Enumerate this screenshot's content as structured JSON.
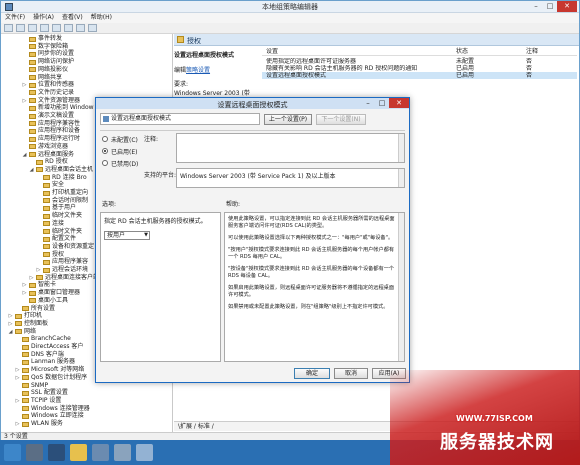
{
  "window": {
    "title": "本地组策略编辑器",
    "ctrl_min": "–",
    "ctrl_max": "□",
    "ctrl_close": "✕"
  },
  "menu": [
    "文件(F)",
    "操作(A)",
    "查看(V)",
    "帮助(H)"
  ],
  "tree": [
    {
      "label": "事件转发",
      "indent": 3,
      "exp": ""
    },
    {
      "label": "数字保险箱",
      "indent": 3,
      "exp": ""
    },
    {
      "label": "同步你的设置",
      "indent": 3,
      "exp": ""
    },
    {
      "label": "网络访问保护",
      "indent": 3,
      "exp": ""
    },
    {
      "label": "网络投影仪",
      "indent": 3,
      "exp": ""
    },
    {
      "label": "网络共享",
      "indent": 3,
      "exp": ""
    },
    {
      "label": "位置和传感器",
      "indent": 3,
      "exp": "▷"
    },
    {
      "label": "文件历史记录",
      "indent": 3,
      "exp": ""
    },
    {
      "label": "文件资源管理器",
      "indent": 3,
      "exp": "▷"
    },
    {
      "label": "新增功能到 Window",
      "indent": 3,
      "exp": ""
    },
    {
      "label": "演示文稿设置",
      "indent": 3,
      "exp": ""
    },
    {
      "label": "应用程序兼容性",
      "indent": 3,
      "exp": ""
    },
    {
      "label": "应用程序和设备",
      "indent": 3,
      "exp": ""
    },
    {
      "label": "应用程序运行时",
      "indent": 3,
      "exp": ""
    },
    {
      "label": "游戏浏览器",
      "indent": 3,
      "exp": ""
    },
    {
      "label": "远程桌面服务",
      "indent": 3,
      "exp": "◢"
    },
    {
      "label": "RD 授权",
      "indent": 4,
      "exp": ""
    },
    {
      "label": "远程桌面会话主机",
      "indent": 4,
      "exp": "◢"
    },
    {
      "label": "RD 连接 Bro",
      "indent": 5,
      "exp": ""
    },
    {
      "label": "安全",
      "indent": 5,
      "exp": ""
    },
    {
      "label": "打印机重定向",
      "indent": 5,
      "exp": ""
    },
    {
      "label": "会话时间限制",
      "indent": 5,
      "exp": ""
    },
    {
      "label": "基于用户",
      "indent": 5,
      "exp": ""
    },
    {
      "label": "临时文件夹",
      "indent": 5,
      "exp": ""
    },
    {
      "label": "连接",
      "indent": 5,
      "exp": ""
    },
    {
      "label": "临时文件夹",
      "indent": 5,
      "exp": ""
    },
    {
      "label": "配置文件",
      "indent": 5,
      "exp": ""
    },
    {
      "label": "设备和资源重定",
      "indent": 5,
      "exp": ""
    },
    {
      "label": "授权",
      "indent": 5,
      "exp": ""
    },
    {
      "label": "应用程序兼容",
      "indent": 5,
      "exp": ""
    },
    {
      "label": "远程会话环境",
      "indent": 5,
      "exp": "▷"
    },
    {
      "label": "远程桌面连接客户端",
      "indent": 4,
      "exp": "▷"
    },
    {
      "label": "智能卡",
      "indent": 3,
      "exp": "▷"
    },
    {
      "label": "桌面窗口管理器",
      "indent": 3,
      "exp": "▷"
    },
    {
      "label": "桌面小工具",
      "indent": 3,
      "exp": ""
    },
    {
      "label": "所有设置",
      "indent": 2,
      "exp": ""
    },
    {
      "label": "打印机",
      "indent": 1,
      "exp": "▷"
    },
    {
      "label": "控制面板",
      "indent": 1,
      "exp": "▷"
    },
    {
      "label": "网络",
      "indent": 1,
      "exp": "◢"
    },
    {
      "label": "BranchCache",
      "indent": 2,
      "exp": ""
    },
    {
      "label": "DirectAccess 客户",
      "indent": 2,
      "exp": ""
    },
    {
      "label": "DNS 客户端",
      "indent": 2,
      "exp": ""
    },
    {
      "label": "Lanman 服务器",
      "indent": 2,
      "exp": ""
    },
    {
      "label": "Microsoft 对等网络",
      "indent": 2,
      "exp": "▷"
    },
    {
      "label": "QoS 数据包计划程序",
      "indent": 2,
      "exp": "▷"
    },
    {
      "label": "SNMP",
      "indent": 2,
      "exp": ""
    },
    {
      "label": "SSL 配置设置",
      "indent": 2,
      "exp": ""
    },
    {
      "label": "TCPIP 设置",
      "indent": 2,
      "exp": "▷"
    },
    {
      "label": "Windows 连接管理器",
      "indent": 2,
      "exp": ""
    },
    {
      "label": "Windows 立即连接",
      "indent": 2,
      "exp": ""
    },
    {
      "label": "WLAN 服务",
      "indent": 2,
      "exp": "▷"
    }
  ],
  "content": {
    "header": "授权",
    "desc_title": "设置远程桌面授权模式",
    "desc_edit_prefix": "编辑",
    "desc_edit_link": "策略设置",
    "desc_req_label": "要求:",
    "desc_req_text": "Windows Server 2003 (带 Service",
    "columns": [
      "设置",
      "状态",
      "注释"
    ],
    "rows": [
      {
        "name": "使用指定的远程桌面许可证服务器",
        "state": "未配置",
        "note": "否"
      },
      {
        "name": "隐藏有关影响 RD 会话主机服务器的 RD 授权问题的通知",
        "state": "已启用",
        "note": "否"
      },
      {
        "name": "设置远程桌面授权模式",
        "state": "已启用",
        "note": "否"
      }
    ],
    "tabs": "\\扩展 / 标准 /",
    "status_left": "3 个设置"
  },
  "dialog": {
    "title": "设置远程桌面授权模式",
    "policy_name": "设置远程桌面授权模式",
    "prev_button": "上一个设置(P)",
    "next_button": "下一个设置(N)",
    "radio_not_configured": "未配置(C)",
    "radio_enabled": "已启用(E)",
    "radio_disabled": "已禁用(D)",
    "comment_label": "注释:",
    "supported_label": "支持的平台:",
    "supported_value": "Windows Server 2003 (带 Service Pack 1) 及以上版本",
    "options_label": "选项:",
    "help_label": "帮助:",
    "options_text": "指定 RD 会话主机服务器的授权模式。",
    "options_select": "按用户",
    "help_paragraphs": [
      "使用此策略设置，可以指定连接到此 RD 会话主机服务器所需的远程桌面服务客户端访问许可证(RDS CAL)的类型。",
      "可以使用此策略设置选择以下两种授权模式之一：\"每用户\"或\"每设备\"。",
      "\"按用户\"授权模式要求连接到此 RD 会话主机服务器的每个用户帐户都有一个 RDS 每用户 CAL。",
      "\"按设备\"授权模式要求连接到此 RD 会话主机服务器的每个设备都有一个 RDS 每设备 CAL。",
      "如果启用此策略设置，则远程桌面许可证服务器将不遵循指定的远程桌面许可模式。",
      "如果禁用或未配置此策略设置，则在\"组策略\"级别上不指定许可模式。"
    ],
    "ok_button": "确定",
    "cancel_button": "取消",
    "apply_button": "应用(A)"
  },
  "watermark": {
    "url": "WWW.77ISP.COM",
    "cn": "服务器技术网"
  },
  "colors": {
    "accent": "#1b6ac2",
    "taskbar": "#2a6fb3",
    "close": "#c7372f"
  }
}
